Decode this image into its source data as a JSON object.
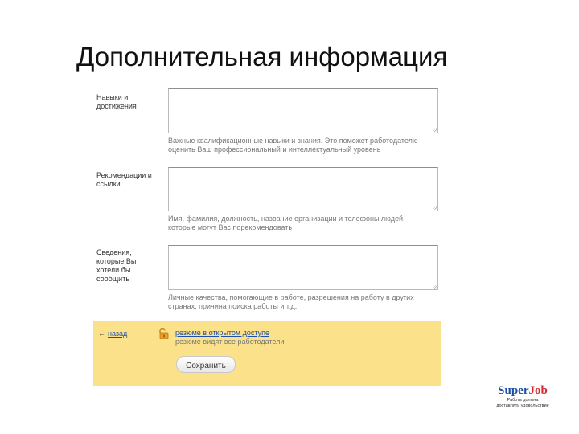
{
  "slide": {
    "title": "Дополнительная информация"
  },
  "fields": [
    {
      "label": "Навыки и достижения",
      "hint": "Важные квалификационные навыки и знания. Это поможет работодателю оценить Ваш профессиональный и интеллектуальный уровень"
    },
    {
      "label": "Рекомендации и ссылки",
      "hint": "Имя, фамилия, должность, название организации и телефоны людей, которые могут Вас порекомендовать"
    },
    {
      "label": "Сведения, которые Вы хотели бы сообщить",
      "hint": "Личные качества, помогающие в работе, разрешения на работу в других странах, причина поиска работы и т.д."
    }
  ],
  "footer": {
    "back_arrow": "←",
    "back_label": "назад",
    "access_title": "резюме в открытом доступе",
    "access_sub": "резюме видят все работодатели",
    "save_label": "Сохранить",
    "panel_color": "#fbe28a"
  },
  "logo": {
    "word_super": "Super",
    "word_job": "Job",
    "tagline_1": "Работа должна",
    "tagline_2": "доставлять удовольствие"
  },
  "icons": {
    "lock": "lock-open-icon",
    "grip": "resize-grip-icon"
  }
}
